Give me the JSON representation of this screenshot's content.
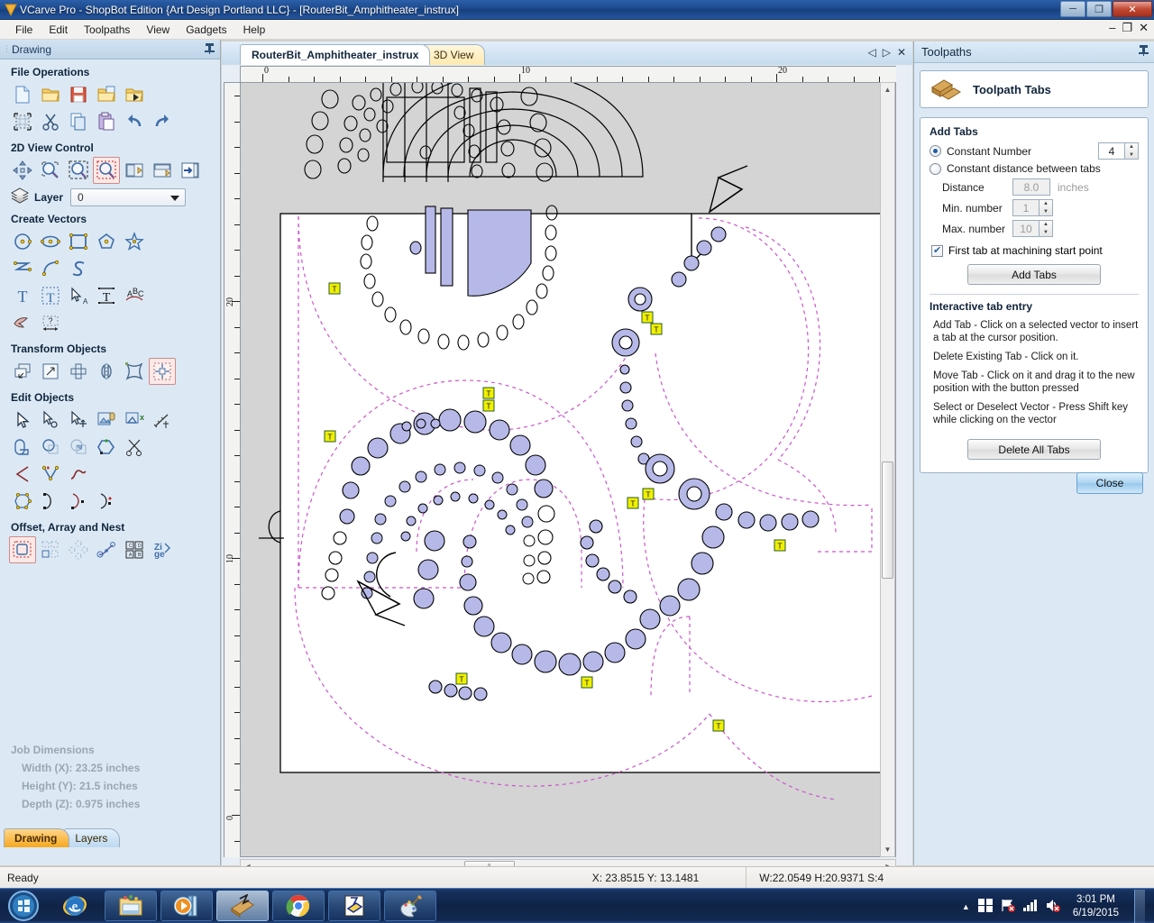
{
  "window": {
    "title": "VCarve Pro - ShopBot Edition {Art Design Portland LLC} - [RouterBit_Amphitheater_instrux]",
    "minimize": "─",
    "maximize": "❐",
    "close": "✕",
    "mdi_minimize": "–",
    "mdi_restore": "❐",
    "mdi_close": "✕"
  },
  "menu": {
    "items": [
      "File",
      "Edit",
      "Toolpaths",
      "View",
      "Gadgets",
      "Help"
    ]
  },
  "left_panel": {
    "title": "Drawing",
    "pin": "📌",
    "sections": [
      {
        "title": "File Operations",
        "rows": [
          [
            "new-file-icon",
            "open-folder-icon",
            "save-icon",
            "save-as-icon",
            "import-icon"
          ],
          [
            "select-all-icon",
            "cut-icon",
            "copy-icon",
            "paste-icon",
            "undo-icon",
            "redo-icon"
          ]
        ]
      },
      {
        "title": "2D View Control",
        "rows": [
          [
            "pan-icon",
            "zoom-window-icon",
            "zoom-extents-icon",
            "zoom-selected-icon",
            "toggle-left-pane-icon",
            "toggle-top-pane-icon",
            "toggle-right-pane-icon"
          ]
        ]
      },
      {
        "title": "Create Vectors",
        "rows": [
          [
            "circle-icon",
            "ellipse-icon",
            "rectangle-icon",
            "polygon-icon",
            "star-icon"
          ],
          [
            "polyline-icon",
            "arc-icon",
            "curve-icon"
          ],
          [
            "text-icon",
            "text-box-icon",
            "text-select-icon",
            "text-on-curve-icon",
            "text-arc-icon"
          ],
          [
            "trace-bitmap-icon",
            "dimension-icon"
          ]
        ]
      },
      {
        "title": "Transform Objects",
        "rows": [
          [
            "move-icon",
            "scale-icon",
            "rotate-icon",
            "mirror-icon",
            "distort-icon",
            "align-icon"
          ]
        ]
      },
      {
        "title": "Edit Objects",
        "rows": [
          [
            "select-arrow-icon",
            "node-edit-icon",
            "move-node-icon",
            "group-icon",
            "ungroup-icon",
            "measure-icon"
          ],
          [
            "weld-icon",
            "subtract-icon",
            "intersect-icon",
            "close-vector-icon",
            "trim-icon"
          ],
          [
            "fillet-icon",
            "join-vectors-icon",
            "smooth-curve-icon"
          ],
          [
            "nest-vector-icon",
            "start-point-icon",
            "insert-point-icon",
            "split-vector-icon"
          ]
        ]
      },
      {
        "title": "Offset, Array and Nest",
        "rows": [
          [
            "offset-icon",
            "array-copy-icon",
            "circular-array-icon",
            "copy-along-curve-icon",
            "block-copy-icon",
            "nest-icon"
          ]
        ]
      }
    ],
    "layer": {
      "label": "Layer",
      "value": "0",
      "icon": "layers-icon"
    },
    "job_dimensions": {
      "title": "Job Dimensions",
      "width": "Width  (X): 23.25 inches",
      "height": "Height (Y): 21.5 inches",
      "depth": "Depth  (Z): 0.975 inches"
    },
    "tabs": [
      {
        "label": "Drawing",
        "selected": true
      },
      {
        "label": "Layers",
        "selected": false
      }
    ]
  },
  "document": {
    "tabs": [
      {
        "label": "RouterBit_Amphitheater_instrux",
        "selected": true
      },
      {
        "label": "3D View",
        "selected": false
      }
    ],
    "nav": {
      "prev": "◁",
      "next": "▷",
      "close": "✕"
    },
    "ruler_h": {
      "labels": [
        "0",
        "10",
        "20"
      ],
      "unit": "inches"
    },
    "ruler_v": {
      "labels": [
        "0",
        "10",
        "20"
      ],
      "unit": "inches"
    },
    "scroll": {
      "up": "▲",
      "down": "▼",
      "left": "◀",
      "right": "▶",
      "thumb_grip": "‖"
    }
  },
  "right_panel": {
    "title": "Toolpaths",
    "pin": "📌",
    "header": {
      "title": "Toolpath Tabs",
      "icon": "toolpath-tabs-icon"
    },
    "add_tabs": {
      "group_title": "Add Tabs",
      "constant_number": {
        "label": "Constant Number",
        "selected": true,
        "value": "4"
      },
      "constant_distance": {
        "label": "Constant distance between tabs",
        "selected": false
      },
      "distance": {
        "label": "Distance",
        "value": "8.0",
        "unit": "inches"
      },
      "min_number": {
        "label": "Min. number",
        "value": "1"
      },
      "max_number": {
        "label": "Max. number",
        "value": "10"
      },
      "first_tab_checkbox": {
        "label": "First tab at machining start point",
        "checked": true
      },
      "add_tabs_button": "Add Tabs"
    },
    "interactive": {
      "title": "Interactive tab entry",
      "paragraphs": [
        "Add Tab - Click on a selected vector to insert a tab at the cursor position.",
        "Delete Existing Tab - Click on it.",
        "Move Tab - Click on it and drag it to the new position with the button pressed",
        "Select or Deselect Vector - Press Shift key while clicking on the vector"
      ],
      "delete_all_button": "Delete All Tabs"
    },
    "close_button": "Close"
  },
  "status_bar": {
    "ready": "Ready",
    "coords": "X: 23.8515 Y: 13.1481",
    "metrics": "W:22.0549  H:20.9371  S:4"
  },
  "taskbar": {
    "start": "start-orb-icon",
    "buttons": [
      {
        "name": "internet-explorer-icon",
        "active": false,
        "boxed": false
      },
      {
        "name": "windows-explorer-icon",
        "active": false,
        "boxed": true
      },
      {
        "name": "windows-media-player-icon",
        "active": false,
        "boxed": true
      },
      {
        "name": "vcarve-pro-icon",
        "active": true,
        "boxed": true
      },
      {
        "name": "google-chrome-icon",
        "active": false,
        "boxed": true
      },
      {
        "name": "vcarve-document-icon",
        "active": false,
        "boxed": true
      },
      {
        "name": "paint-icon",
        "active": false,
        "boxed": true
      }
    ],
    "tray": {
      "show_hidden": "▲",
      "icons": [
        "action-center-icon",
        "network-icon",
        "signal-icon",
        "volume-muted-icon"
      ],
      "time": "3:01 PM",
      "date": "6/19/2015"
    }
  },
  "canvas": {
    "material_color": "#d4d4d4",
    "sheet_color": "#ffffff",
    "toolpath_color": "#cc55cc",
    "vector_fill": "#b6b9e8",
    "vector_stroke": "#000000",
    "tab_marker_label": "T",
    "tab_marker_color": "#f0f000"
  }
}
